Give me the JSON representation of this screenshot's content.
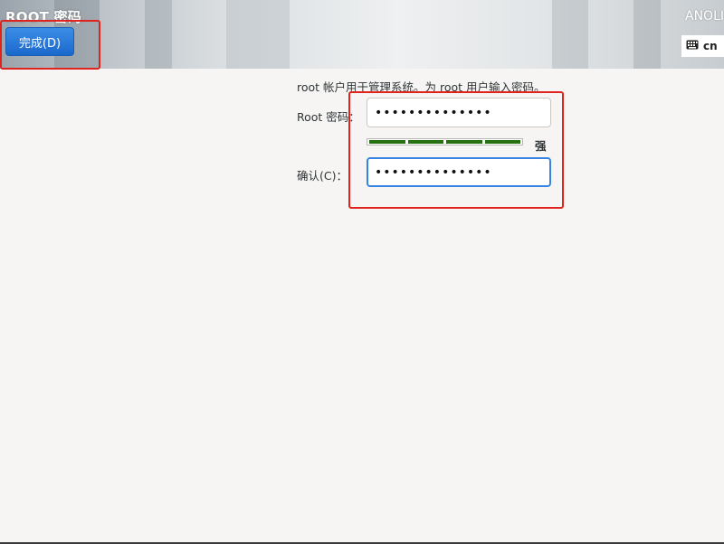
{
  "header": {
    "title": "ROOT 密码",
    "done_label": "完成(D)",
    "brand": "ANOLI",
    "keyboard_layout": "cn",
    "keyboard_icon": "keyboard-icon"
  },
  "form": {
    "description": "root 帐户用于管理系统。为 root 用户输入密码。",
    "root_password_label": "Root 密码：",
    "root_password_value": "••••••••••••••",
    "strength_label": "强",
    "strength_fraction": 1.0,
    "confirm_label": "确认(C)：",
    "confirm_value": "••••••••••••••"
  },
  "colors": {
    "accent": "#3584e4",
    "button": "#1b68cc",
    "strength_bar": "#26700f",
    "highlight_box": "#e0231c"
  }
}
